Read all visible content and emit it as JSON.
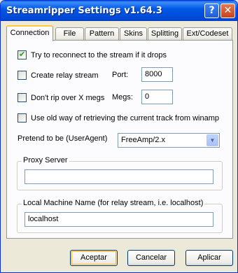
{
  "window": {
    "title": "Streamripper Settings v1.64.3"
  },
  "titlebar": {
    "help_label": "?",
    "close_label": "✕"
  },
  "tabs": [
    {
      "label": "Connection",
      "active": true
    },
    {
      "label": "File"
    },
    {
      "label": "Pattern"
    },
    {
      "label": "Skins"
    },
    {
      "label": "Splitting"
    },
    {
      "label": "Ext/Codeset"
    }
  ],
  "connection": {
    "reconnect": {
      "label": "Try to reconnect to the stream if it drops",
      "checked": true
    },
    "relay": {
      "label": "Create relay stream",
      "checked": false
    },
    "port": {
      "label": "Port:",
      "value": "8000"
    },
    "no_rip": {
      "label": "Don't rip over X megs",
      "checked": false
    },
    "megs": {
      "label": "Megs:",
      "value": "0"
    },
    "old_way": {
      "label": "Use old way of retrieving the current track from winamp",
      "checked": false
    },
    "useragent": {
      "label": "Pretend to be (UserAgent)",
      "value": "FreeAmp/2.x"
    },
    "proxy": {
      "title": "Proxy Server",
      "value": ""
    },
    "local_machine": {
      "title": "Local Machine Name (for relay stream, i.e. localhost)",
      "value": "localhost"
    }
  },
  "buttons": {
    "ok": "Aceptar",
    "cancel": "Cancelar",
    "apply": "Aplicar"
  },
  "colors": {
    "titlebar": "#0058e6",
    "dialog_bg": "#ece9d8",
    "active_tab_accent": "#ffc83c"
  }
}
